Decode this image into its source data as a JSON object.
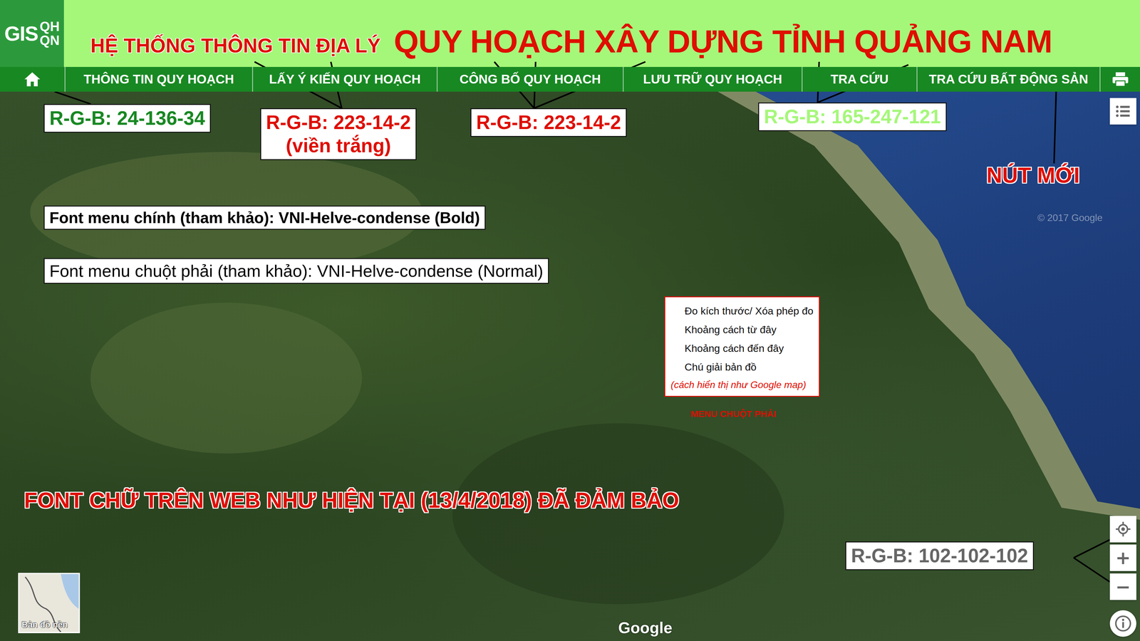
{
  "header": {
    "logo": {
      "main": "GIS",
      "stack": [
        "QH",
        "QN"
      ]
    },
    "subtitle": "HỆ THỐNG THÔNG TIN ĐỊA LÝ",
    "title": "QUY HOẠCH XÂY DỰNG TỈNH QUẢNG NAM"
  },
  "nav": {
    "items": [
      "THÔNG TIN QUY HOẠCH",
      "LẤY Ý KIẾN QUY HOẠCH",
      "CÔNG BỐ QUY HOẠCH",
      "LƯU TRỮ QUY HOẠCH",
      "TRA CỨU",
      "TRA CỨU BẤT ĐỘNG SẢN"
    ]
  },
  "map": {
    "base_layer": "Bản đồ nền",
    "attribution": "Google",
    "copyright": "© 2017 Google",
    "zoom": [
      "+",
      "−"
    ]
  },
  "context_menu": {
    "items": [
      "Đo kích thước/ Xóa phép đo",
      "Khoảng cách từ đây",
      "Khoảng cách đến đây",
      "Chú giải bản đồ"
    ],
    "note": "(cách hiển thị như Google map)",
    "caption": "MENU CHUỘT PHẢI"
  },
  "annotations": {
    "nav_color": {
      "kind": "box",
      "lines": [
        "R-G-B: 24-136-34"
      ],
      "color": "#188822",
      "bold": true
    },
    "subtitle_color": {
      "kind": "box",
      "lines": [
        "R-G-B: 223-14-2",
        "(viền trắng)"
      ],
      "color": "#df0e02",
      "bold": true
    },
    "title_color": {
      "kind": "box",
      "lines": [
        "R-G-B: 223-14-2"
      ],
      "color": "#df0e02",
      "bold": true
    },
    "header_color": {
      "kind": "box",
      "lines": [
        "R-G-B: 165-247-121"
      ],
      "color": "#a5f779",
      "bold": true
    },
    "new_button": {
      "kind": "outline",
      "lines": [
        "NÚT MỚI"
      ],
      "color": "#df0e02",
      "bold": true
    },
    "main_font": {
      "kind": "box",
      "lines": [
        "Font menu chính (tham khảo): VNI-Helve-condense (Bold)"
      ],
      "color": "#000000",
      "bold": true
    },
    "context_font": {
      "kind": "box",
      "lines": [
        "Font menu chuột phải (tham khảo): VNI-Helve-condense (Normal)"
      ],
      "color": "#000000",
      "bold": false
    },
    "web_font": {
      "kind": "outline",
      "lines": [
        "FONT CHỮ TRÊN WEB NHƯ HIỆN TẠI (13/4/2018) ĐÃ ĐẢM BẢO"
      ],
      "color": "#df0e02",
      "bold": true
    },
    "control_color": {
      "kind": "box",
      "lines": [
        "R-G-B: 102-102-102"
      ],
      "color": "#666666",
      "bold": true
    }
  }
}
